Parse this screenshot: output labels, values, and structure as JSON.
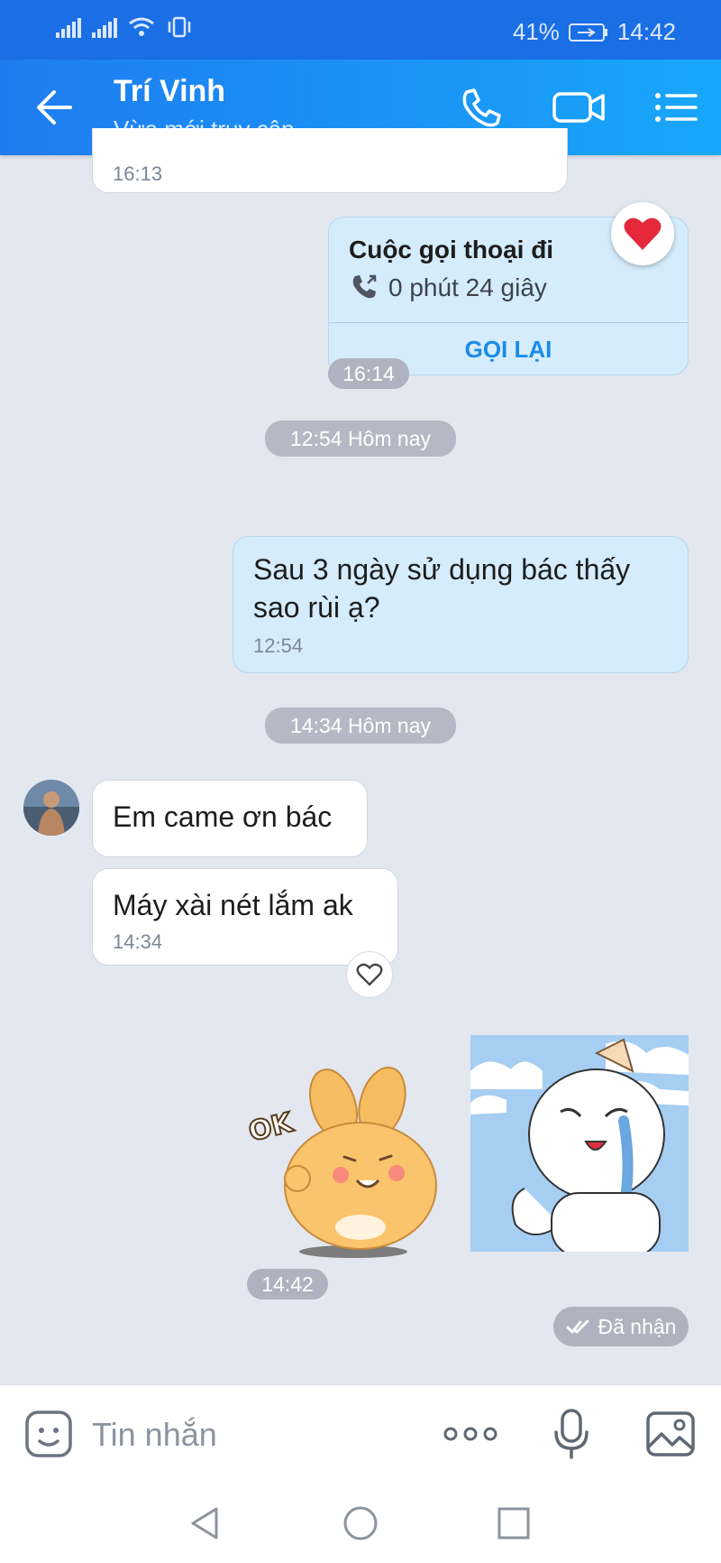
{
  "status_bar": {
    "battery": "41%",
    "time": "14:42"
  },
  "header": {
    "title": "Trí Vinh",
    "subtitle": "Vừa mới truy cập"
  },
  "messages": {
    "top_time": "16:13",
    "call": {
      "title": "Cuộc gọi thoại đi",
      "duration": "0 phút 24 giây",
      "action": "GỌI LẠI",
      "time": "16:14"
    },
    "separator1": "12:54 Hôm nay",
    "out1": {
      "line1": "Sau 3 ngày sử dụng bác thấy",
      "line2": "sao rùi ạ?",
      "time": "12:54"
    },
    "separator2": "14:34 Hôm nay",
    "in1": {
      "text": "Em came ơn bác"
    },
    "in2": {
      "text": "Máy xài nét lắm ak",
      "time": "14:34"
    },
    "sticker_label": "OK",
    "sticker_time": "14:42",
    "status": "Đã nhận"
  },
  "composer": {
    "placeholder": "Tin nhắn"
  },
  "icons": [
    "back-arrow-icon",
    "phone-icon",
    "video-call-icon",
    "menu-icon",
    "heart-icon",
    "outgoing-call-icon",
    "emoji-icon",
    "more-icon",
    "microphone-icon",
    "image-icon",
    "nav-back-icon",
    "nav-home-icon",
    "nav-recents-icon"
  ],
  "colors": {
    "accent": "#1e7cf0",
    "outgoing_bubble": "#d4ecfc",
    "link": "#1a8be6"
  }
}
